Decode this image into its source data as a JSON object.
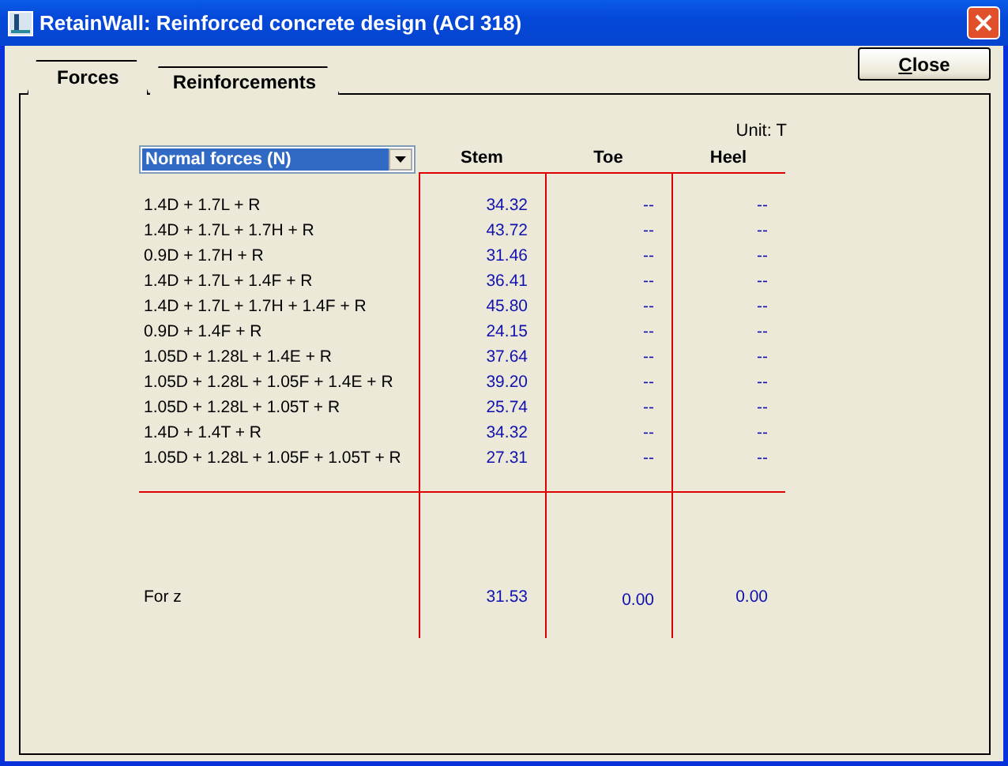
{
  "window": {
    "title": "RetainWall: Reinforced concrete design (ACI 318)"
  },
  "tabs": [
    {
      "label": "Forces",
      "selected": true
    },
    {
      "label": "Reinforcements",
      "selected": false
    }
  ],
  "close_button": {
    "label": "Close"
  },
  "unit": "Unit: T",
  "dropdown": {
    "value": "Normal forces (N)"
  },
  "table": {
    "columns": [
      "Stem",
      "Toe",
      "Heel"
    ],
    "rows": [
      {
        "label": "1.4D + 1.7L + R",
        "cells": [
          "34.32",
          "--",
          "--"
        ]
      },
      {
        "label": "1.4D + 1.7L + 1.7H + R",
        "cells": [
          "43.72",
          "--",
          "--"
        ]
      },
      {
        "label": "0.9D + 1.7H + R",
        "cells": [
          "31.46",
          "--",
          "--"
        ]
      },
      {
        "label": "1.4D + 1.7L + 1.4F + R",
        "cells": [
          "36.41",
          "--",
          "--"
        ]
      },
      {
        "label": "1.4D + 1.7L + 1.7H + 1.4F + R",
        "cells": [
          "45.80",
          "--",
          "--"
        ]
      },
      {
        "label": "0.9D + 1.4F + R",
        "cells": [
          "24.15",
          "--",
          "--"
        ]
      },
      {
        "label": "1.05D + 1.28L + 1.4E + R",
        "cells": [
          "37.64",
          "--",
          "--"
        ]
      },
      {
        "label": "1.05D + 1.28L + 1.05F + 1.4E + R",
        "cells": [
          "39.20",
          "--",
          "--"
        ]
      },
      {
        "label": "1.05D + 1.28L + 1.05T + R",
        "cells": [
          "25.74",
          "--",
          "--"
        ]
      },
      {
        "label": "1.4D + 1.4T + R",
        "cells": [
          "34.32",
          "--",
          "--"
        ]
      },
      {
        "label": "1.05D + 1.28L + 1.05F + 1.05T + R",
        "cells": [
          "27.31",
          "--",
          "--"
        ]
      }
    ],
    "summary": {
      "label": "For z",
      "cells": [
        "31.53",
        "0.00",
        "0.00"
      ]
    }
  }
}
